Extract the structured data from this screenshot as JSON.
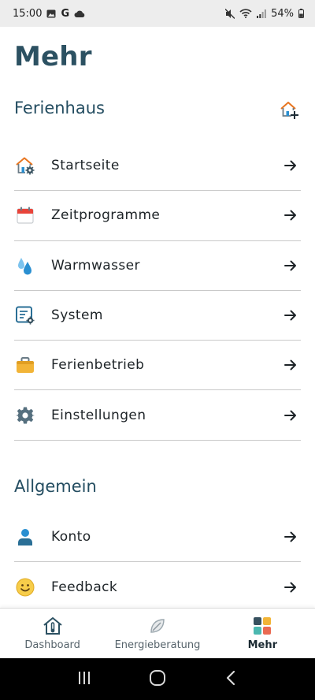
{
  "status_bar": {
    "time": "15:00",
    "carrier_glyph": "G",
    "battery": "54%",
    "icons": [
      "image-icon",
      "google-icon",
      "cloud-icon",
      "mute-icon",
      "wifi-icon",
      "signal-icon",
      "battery-icon"
    ]
  },
  "page": {
    "title": "Mehr"
  },
  "sections": {
    "ferienhaus": {
      "title": "Ferienhaus",
      "add_icon": "house-add-icon",
      "items": [
        {
          "label": "Startseite",
          "icon": "house-gear-icon"
        },
        {
          "label": "Zeitprogramme",
          "icon": "calendar-icon"
        },
        {
          "label": "Warmwasser",
          "icon": "water-drops-icon"
        },
        {
          "label": "System",
          "icon": "system-settings-icon"
        },
        {
          "label": "Ferienbetrieb",
          "icon": "suitcase-icon"
        },
        {
          "label": "Einstellungen",
          "icon": "gear-icon"
        }
      ]
    },
    "allgemein": {
      "title": "Allgemein",
      "items": [
        {
          "label": "Konto",
          "icon": "person-icon"
        },
        {
          "label": "Feedback",
          "icon": "smiley-icon"
        }
      ]
    }
  },
  "bottom_nav": {
    "items": [
      {
        "label": "Dashboard",
        "icon": "house-thermometer-icon",
        "active": false
      },
      {
        "label": "Energieberatung",
        "icon": "leaf-icon",
        "active": false
      },
      {
        "label": "Mehr",
        "icon": "tiles-icon",
        "active": true
      }
    ]
  },
  "colors": {
    "title": "#2c5162",
    "section_title": "#244d61",
    "accent_orange": "#f07a2a",
    "accent_blue": "#2a8fd1",
    "status_bar_bg": "#ededed",
    "divider": "#c9c9c9"
  }
}
